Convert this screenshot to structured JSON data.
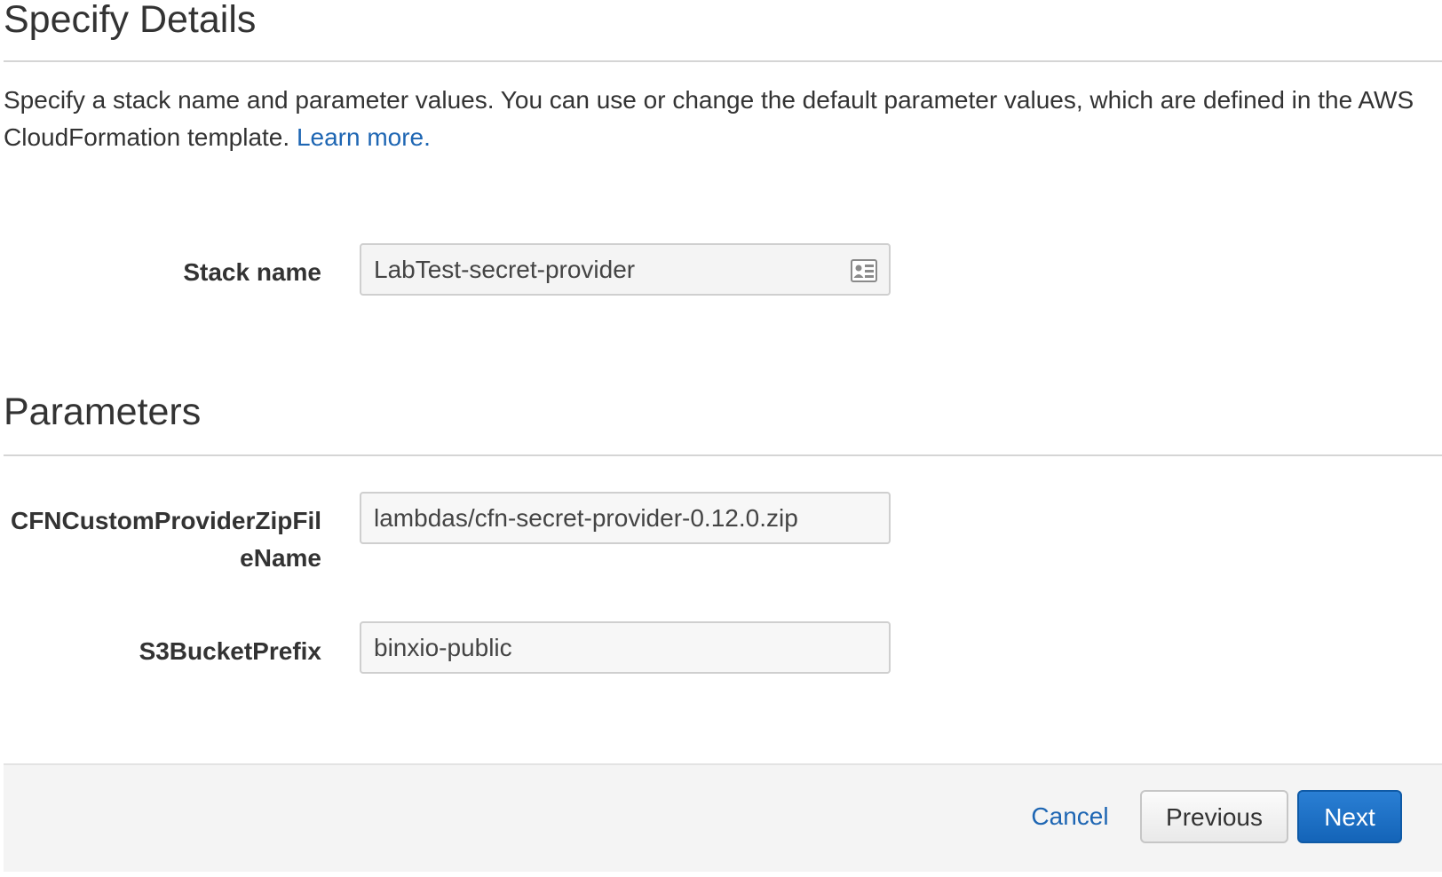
{
  "header": {
    "title": "Specify Details",
    "description": "Specify a stack name and parameter values. You can use or change the default parameter values, which are defined in the AWS CloudFormation template.",
    "learn_more": "Learn more."
  },
  "stack": {
    "label": "Stack name",
    "value": "LabTest-secret-provider",
    "icon": "contact-card-icon"
  },
  "parameters": {
    "title": "Parameters",
    "items": [
      {
        "label_line1": "CFNCustomProviderZipFil",
        "label_line2": "eName",
        "value": "lambdas/cfn-secret-provider-0.12.0.zip"
      },
      {
        "label": "S3BucketPrefix",
        "value": "binxio-public"
      }
    ]
  },
  "footer": {
    "cancel": "Cancel",
    "previous": "Previous",
    "next": "Next"
  },
  "colors": {
    "link": "#1e66b3",
    "primary_button": "#1464b8",
    "footer_bg": "#f4f4f4"
  }
}
